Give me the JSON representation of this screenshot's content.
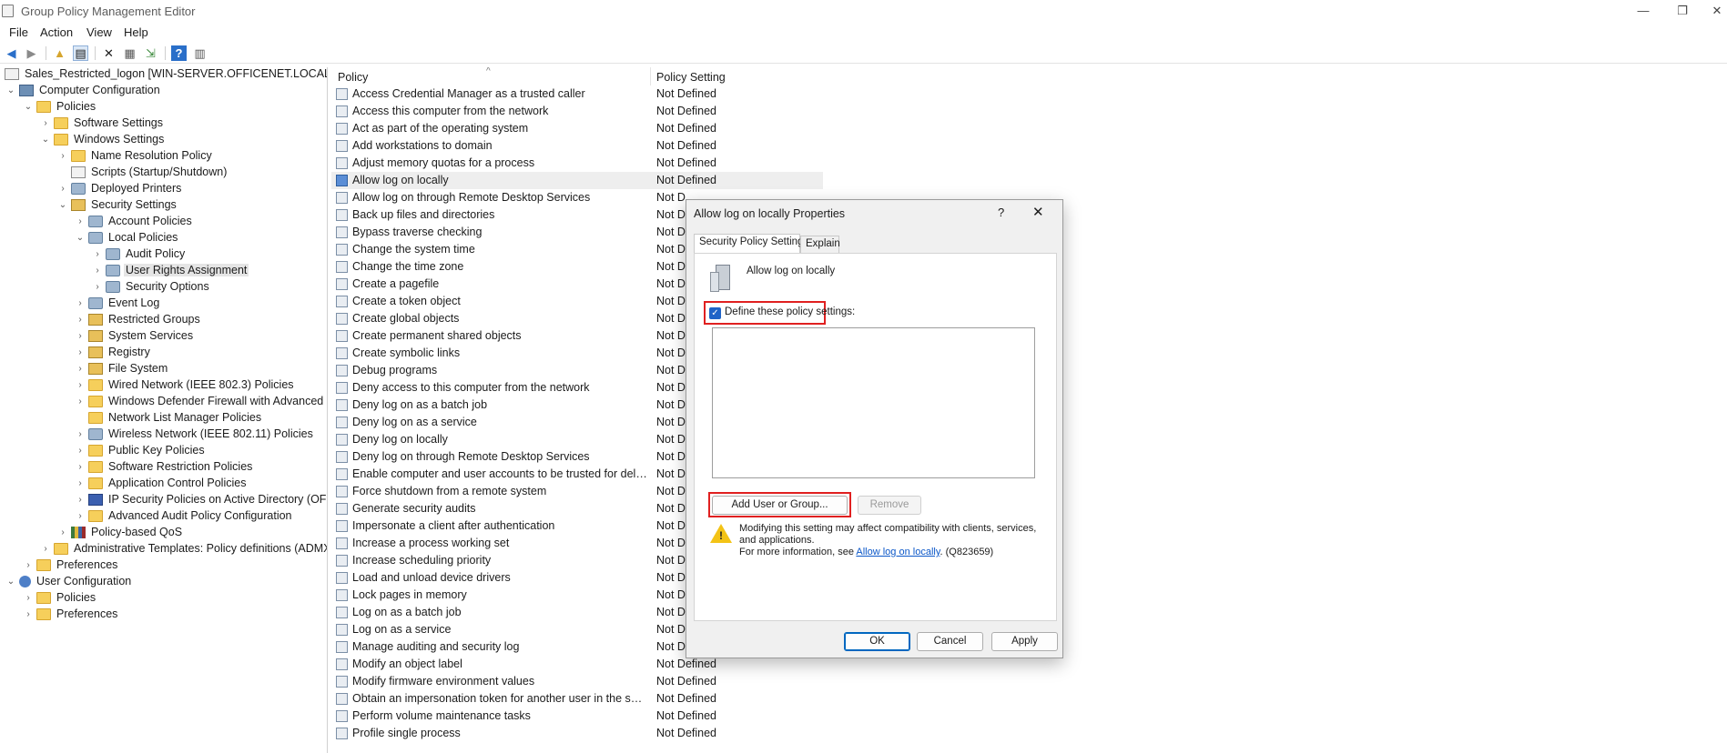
{
  "window": {
    "title": "Group Policy Management Editor",
    "minimize": "—",
    "maximize": "❐",
    "close": "✕"
  },
  "menu": [
    "File",
    "Action",
    "View",
    "Help"
  ],
  "tree": [
    {
      "label": "Sales_Restricted_logon [WIN-SERVER.OFFICENET.LOCAL] Policy",
      "depth": 0,
      "exp": "none",
      "icon": "doc"
    },
    {
      "label": "Computer Configuration",
      "depth": 0,
      "exp": "open",
      "icon": "comp"
    },
    {
      "label": "Policies",
      "depth": 1,
      "exp": "open",
      "icon": "folder"
    },
    {
      "label": "Software Settings",
      "depth": 2,
      "exp": "closed",
      "icon": "folder"
    },
    {
      "label": "Windows Settings",
      "depth": 2,
      "exp": "open",
      "icon": "folder"
    },
    {
      "label": "Name Resolution Policy",
      "depth": 3,
      "exp": "closed",
      "icon": "folder"
    },
    {
      "label": "Scripts (Startup/Shutdown)",
      "depth": 3,
      "exp": "none",
      "icon": "doc"
    },
    {
      "label": "Deployed Printers",
      "depth": 3,
      "exp": "closed",
      "icon": "gear"
    },
    {
      "label": "Security Settings",
      "depth": 3,
      "exp": "open",
      "icon": "lock"
    },
    {
      "label": "Account Policies",
      "depth": 4,
      "exp": "closed",
      "icon": "gear"
    },
    {
      "label": "Local Policies",
      "depth": 4,
      "exp": "open",
      "icon": "gear"
    },
    {
      "label": "Audit Policy",
      "depth": 5,
      "exp": "closed",
      "icon": "gear"
    },
    {
      "label": "User Rights Assignment",
      "depth": 5,
      "exp": "closed",
      "icon": "gear",
      "selected": true
    },
    {
      "label": "Security Options",
      "depth": 5,
      "exp": "closed",
      "icon": "gear"
    },
    {
      "label": "Event Log",
      "depth": 4,
      "exp": "closed",
      "icon": "gear"
    },
    {
      "label": "Restricted Groups",
      "depth": 4,
      "exp": "closed",
      "icon": "lock"
    },
    {
      "label": "System Services",
      "depth": 4,
      "exp": "closed",
      "icon": "lock"
    },
    {
      "label": "Registry",
      "depth": 4,
      "exp": "closed",
      "icon": "lock"
    },
    {
      "label": "File System",
      "depth": 4,
      "exp": "closed",
      "icon": "lock"
    },
    {
      "label": "Wired Network (IEEE 802.3) Policies",
      "depth": 4,
      "exp": "closed",
      "icon": "folder"
    },
    {
      "label": "Windows Defender Firewall with Advanced Se",
      "depth": 4,
      "exp": "closed",
      "icon": "folder"
    },
    {
      "label": "Network List Manager Policies",
      "depth": 4,
      "exp": "none",
      "icon": "folder"
    },
    {
      "label": "Wireless Network (IEEE 802.11) Policies",
      "depth": 4,
      "exp": "closed",
      "icon": "gear"
    },
    {
      "label": "Public Key Policies",
      "depth": 4,
      "exp": "closed",
      "icon": "folder"
    },
    {
      "label": "Software Restriction Policies",
      "depth": 4,
      "exp": "closed",
      "icon": "folder"
    },
    {
      "label": "Application Control Policies",
      "depth": 4,
      "exp": "closed",
      "icon": "folder"
    },
    {
      "label": "IP Security Policies on Active Directory (OFFIC",
      "depth": 4,
      "exp": "closed",
      "icon": "shield"
    },
    {
      "label": "Advanced Audit Policy Configuration",
      "depth": 4,
      "exp": "closed",
      "icon": "folder"
    },
    {
      "label": "Policy-based QoS",
      "depth": 3,
      "exp": "closed",
      "icon": "qos"
    },
    {
      "label": "Administrative Templates: Policy definitions (ADMX",
      "depth": 2,
      "exp": "closed",
      "icon": "folder"
    },
    {
      "label": "Preferences",
      "depth": 1,
      "exp": "closed",
      "icon": "folder"
    },
    {
      "label": "User Configuration",
      "depth": 0,
      "exp": "open",
      "icon": "user"
    },
    {
      "label": "Policies",
      "depth": 1,
      "exp": "closed",
      "icon": "folder"
    },
    {
      "label": "Preferences",
      "depth": 1,
      "exp": "closed",
      "icon": "folder"
    }
  ],
  "list": {
    "col_policy": "Policy",
    "col_setting": "Policy Setting",
    "sort_indicator": "^",
    "rows": [
      {
        "name": "Access Credential Manager as a trusted caller",
        "setting": "Not Defined"
      },
      {
        "name": "Access this computer from the network",
        "setting": "Not Defined"
      },
      {
        "name": "Act as part of the operating system",
        "setting": "Not Defined"
      },
      {
        "name": "Add workstations to domain",
        "setting": "Not Defined"
      },
      {
        "name": "Adjust memory quotas for a process",
        "setting": "Not Defined"
      },
      {
        "name": "Allow log on locally",
        "setting": "Not Defined",
        "selected": true
      },
      {
        "name": "Allow log on through Remote Desktop Services",
        "setting": "Not D"
      },
      {
        "name": "Back up files and directories",
        "setting": "Not D"
      },
      {
        "name": "Bypass traverse checking",
        "setting": "Not D"
      },
      {
        "name": "Change the system time",
        "setting": "Not D"
      },
      {
        "name": "Change the time zone",
        "setting": "Not D"
      },
      {
        "name": "Create a pagefile",
        "setting": "Not D"
      },
      {
        "name": "Create a token object",
        "setting": "Not D"
      },
      {
        "name": "Create global objects",
        "setting": "Not D"
      },
      {
        "name": "Create permanent shared objects",
        "setting": "Not D"
      },
      {
        "name": "Create symbolic links",
        "setting": "Not D"
      },
      {
        "name": "Debug programs",
        "setting": "Not D"
      },
      {
        "name": "Deny access to this computer from the network",
        "setting": "Not D"
      },
      {
        "name": "Deny log on as a batch job",
        "setting": "Not D"
      },
      {
        "name": "Deny log on as a service",
        "setting": "Not D"
      },
      {
        "name": "Deny log on locally",
        "setting": "Not D"
      },
      {
        "name": "Deny log on through Remote Desktop Services",
        "setting": "Not D"
      },
      {
        "name": "Enable computer and user accounts to be trusted for delega...",
        "setting": "Not D"
      },
      {
        "name": "Force shutdown from a remote system",
        "setting": "Not D"
      },
      {
        "name": "Generate security audits",
        "setting": "Not D"
      },
      {
        "name": "Impersonate a client after authentication",
        "setting": "Not D"
      },
      {
        "name": "Increase a process working set",
        "setting": "Not D"
      },
      {
        "name": "Increase scheduling priority",
        "setting": "Not D"
      },
      {
        "name": "Load and unload device drivers",
        "setting": "Not D"
      },
      {
        "name": "Lock pages in memory",
        "setting": "Not D"
      },
      {
        "name": "Log on as a batch job",
        "setting": "Not D"
      },
      {
        "name": "Log on as a service",
        "setting": "Not D"
      },
      {
        "name": "Manage auditing and security log",
        "setting": "Not D"
      },
      {
        "name": "Modify an object label",
        "setting": "Not Defined"
      },
      {
        "name": "Modify firmware environment values",
        "setting": "Not Defined"
      },
      {
        "name": "Obtain an impersonation token for another user in the same...",
        "setting": "Not Defined"
      },
      {
        "name": "Perform volume maintenance tasks",
        "setting": "Not Defined"
      },
      {
        "name": "Profile single process",
        "setting": "Not Defined"
      }
    ]
  },
  "dialog": {
    "title": "Allow log on locally Properties",
    "help": "?",
    "close": "✕",
    "tab_security": "Security Policy Setting",
    "tab_explain": "Explain",
    "policy_name": "Allow log on locally",
    "define_label": "Define these policy settings:",
    "add_button": "Add User or Group...",
    "remove_button": "Remove",
    "warning_text": "Modifying this setting may affect compatibility with clients, services, and applications.",
    "more_info_prefix": "For more information, see ",
    "more_info_link": "Allow log on locally",
    "more_info_suffix": ". (Q823659)",
    "ok": "OK",
    "cancel": "Cancel",
    "apply": "Apply"
  }
}
